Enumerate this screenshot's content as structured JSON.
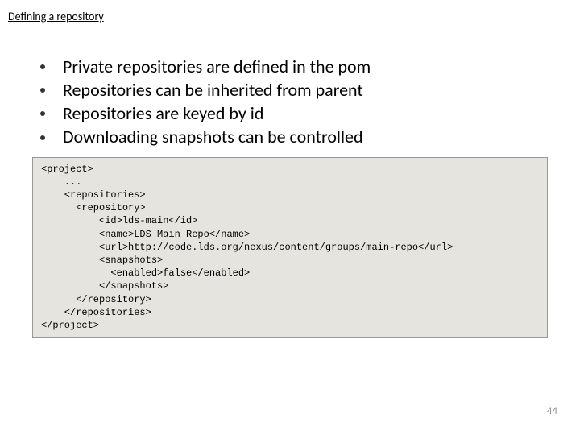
{
  "title": "Defining a repository",
  "bullets": [
    "Private repositories are defined in the pom",
    "Repositories can be inherited from parent",
    "Repositories are keyed by id",
    "Downloading snapshots can be controlled"
  ],
  "code": "<project>\n    ...\n    <repositories>\n      <repository>\n          <id>lds-main</id>\n          <name>LDS Main Repo</name>\n          <url>http://code.lds.org/nexus/content/groups/main-repo</url>\n          <snapshots>\n            <enabled>false</enabled>\n          </snapshots>\n      </repository>\n    </repositories>\n</project>",
  "pageNumber": "44"
}
